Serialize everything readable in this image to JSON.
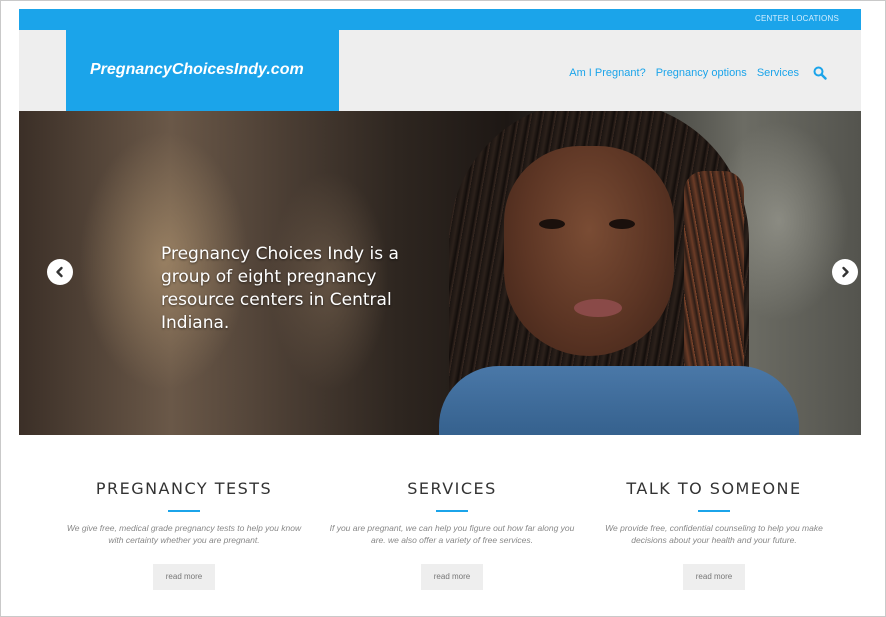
{
  "topbar": {
    "center_locations": "CENTER LOCATIONS"
  },
  "header": {
    "logo": "PregnancyChoicesIndy.com",
    "nav": [
      "Am I Pregnant?",
      "Pregnancy options",
      "Services"
    ],
    "search_icon": "search-icon"
  },
  "hero": {
    "headline": "Pregnancy Choices Indy is a group of eight pregnancy resource centers in Central Indiana.",
    "prev_icon": "chevron-left-icon",
    "next_icon": "chevron-right-icon"
  },
  "features": [
    {
      "title": "PREGNANCY TESTS",
      "text": "We give free, medical grade pregnancy tests to help you know with certainty whether you are pregnant.",
      "button": "read more"
    },
    {
      "title": "SERVICES",
      "text": "If you are pregnant, we can help you figure out how far along you are. we also offer a variety of free services.",
      "button": "read more"
    },
    {
      "title": "TALK TO SOMEONE",
      "text": "We provide free, confidential counseling to help you make decisions about your health and your future.",
      "button": "read more"
    }
  ],
  "colors": {
    "accent": "#1ba4ea",
    "header_bg": "#eeeeee"
  }
}
